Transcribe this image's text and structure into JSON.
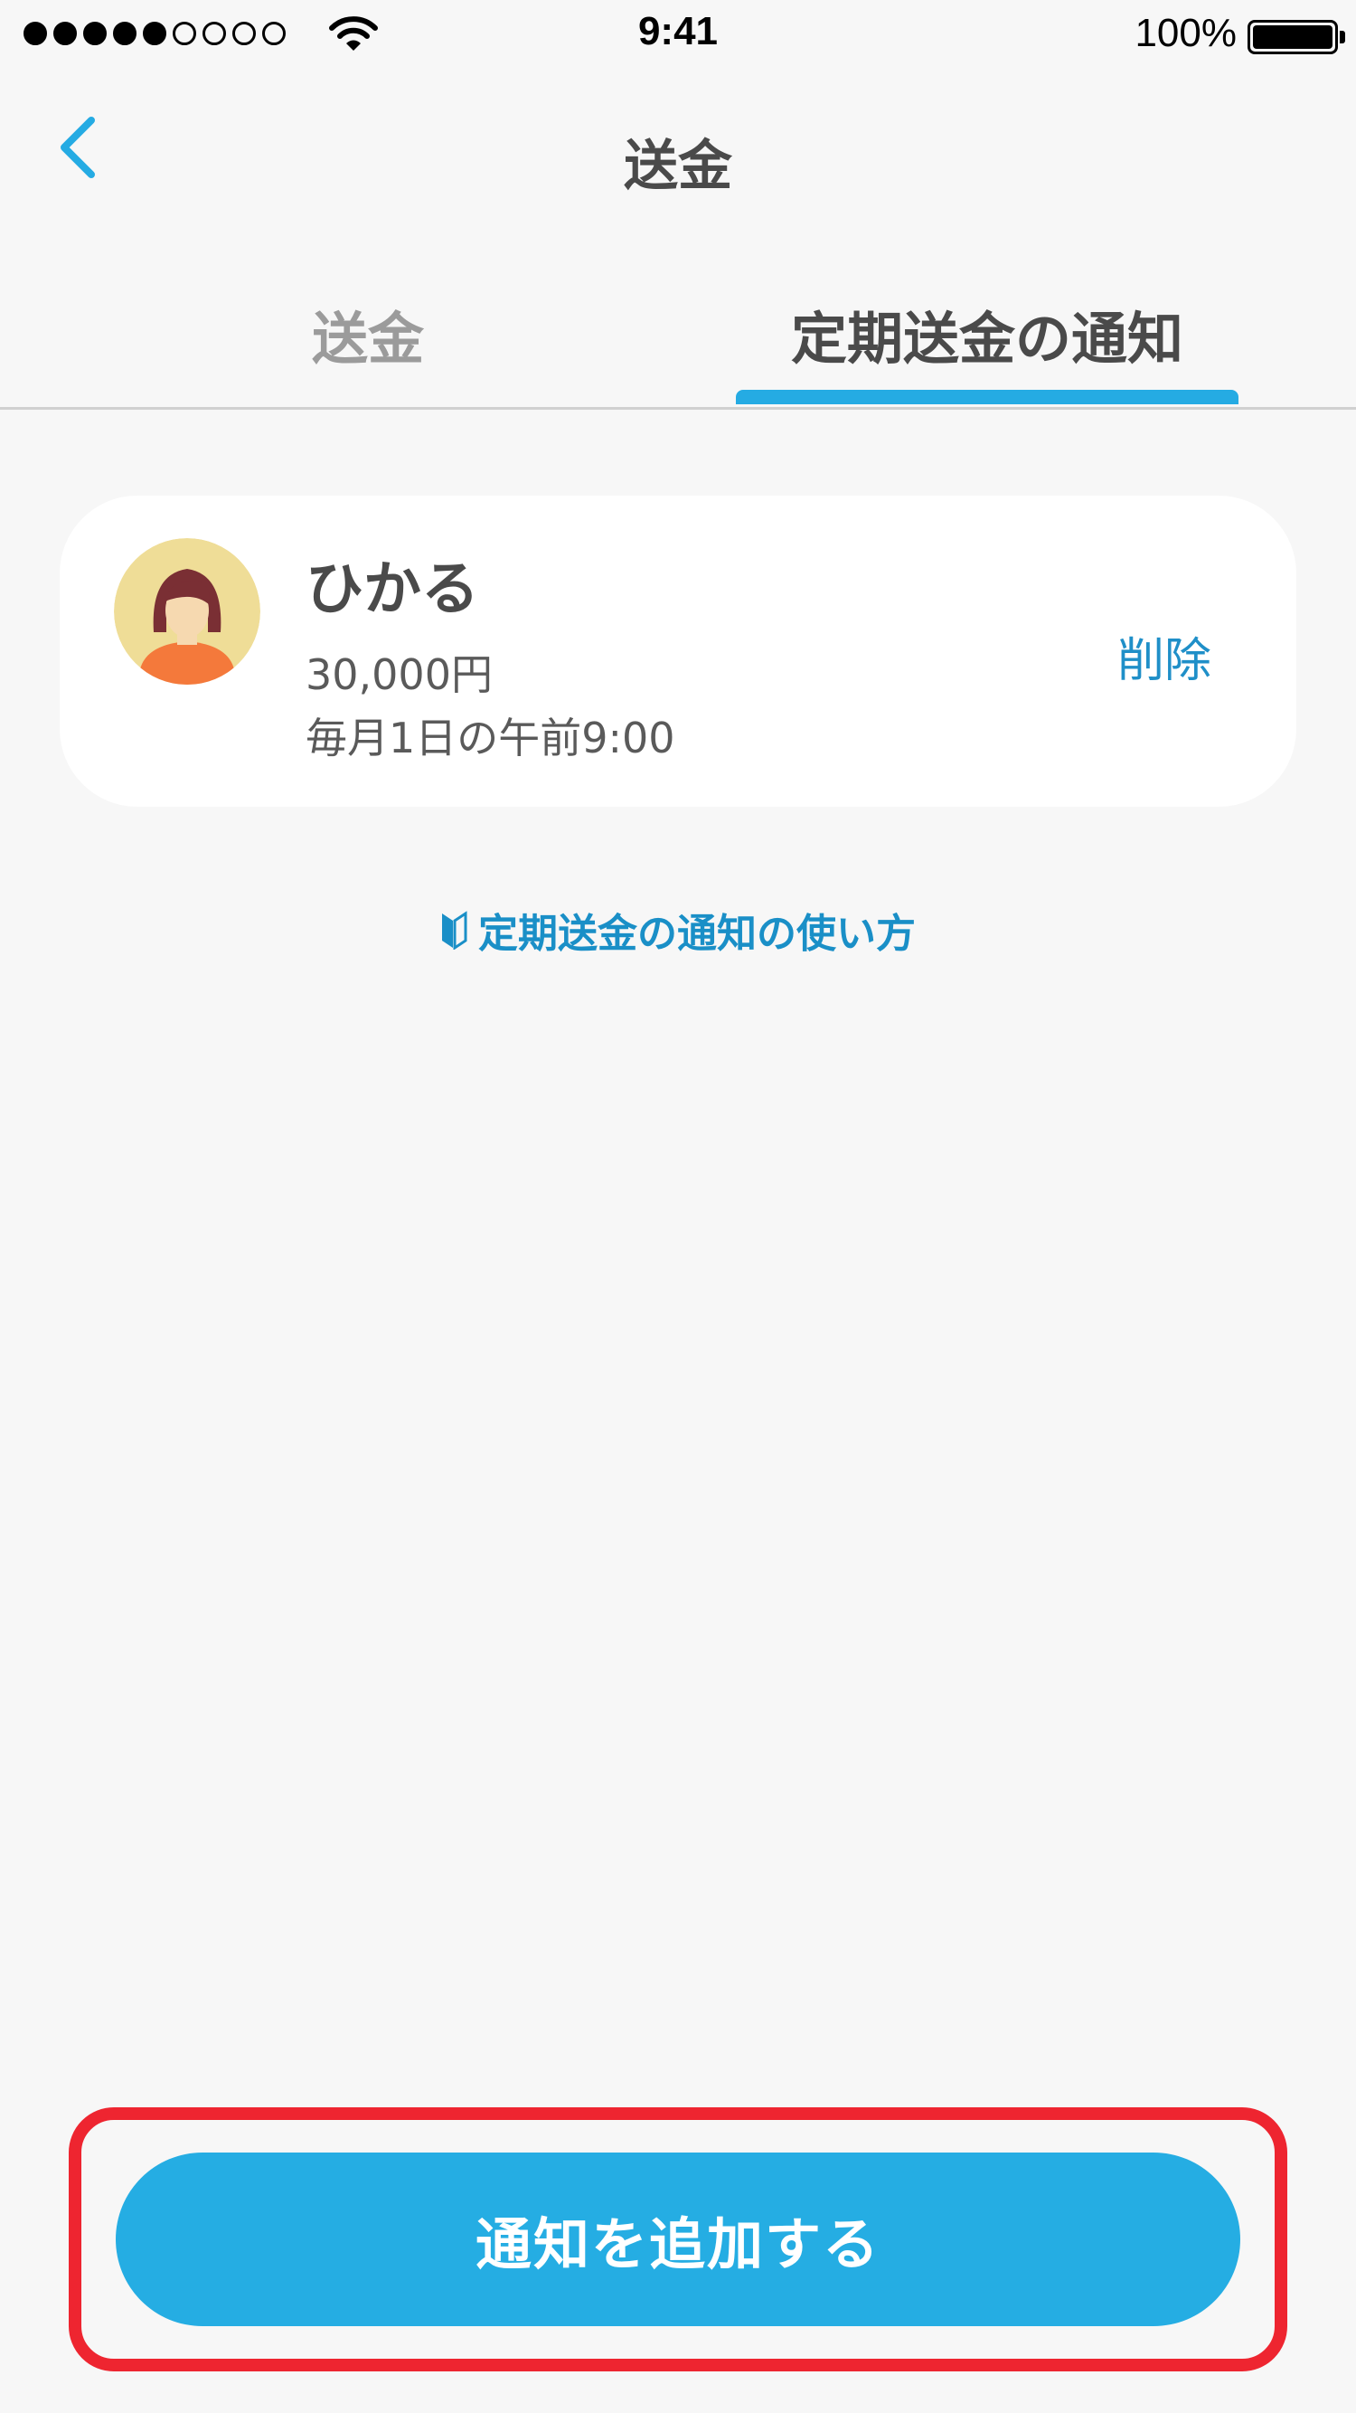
{
  "status_bar": {
    "time": "9:41",
    "battery_percent": "100%",
    "signal_filled": 5,
    "signal_total": 9
  },
  "nav": {
    "title": "送金",
    "back_icon": "chevron-left-icon"
  },
  "tabs": [
    {
      "label": "送金",
      "active": false
    },
    {
      "label": "定期送金の通知",
      "active": true
    }
  ],
  "notification": {
    "name": "ひかる",
    "amount": "30,000円",
    "schedule": "毎月1日の午前9:00",
    "delete_label": "削除"
  },
  "help": {
    "label": "定期送金の通知の使い方",
    "icon": "beginner-mark-icon"
  },
  "add_button": {
    "label": "通知を追加する"
  },
  "colors": {
    "accent": "#25abe3",
    "link": "#1f8fc8",
    "highlight": "#ee2530",
    "background": "#f7f7f7"
  }
}
